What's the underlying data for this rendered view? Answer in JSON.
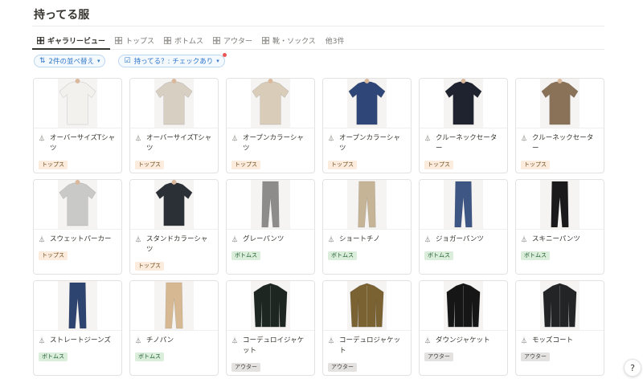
{
  "page": {
    "title": "持ってる服"
  },
  "tabs": [
    {
      "label": "ギャラリービュー",
      "active": true
    },
    {
      "label": "トップス",
      "active": false
    },
    {
      "label": "ボトムス",
      "active": false
    },
    {
      "label": "アウター",
      "active": false
    },
    {
      "label": "靴・ソックス",
      "active": false
    }
  ],
  "tabs_more": "他3件",
  "filters": {
    "sort_label": "2件の並べ替え",
    "filter_label": "持ってる？: チェックあり"
  },
  "categories": {
    "tops": "トップス",
    "bottoms": "ボトムス",
    "outer": "アウター"
  },
  "cards": [
    {
      "name": "オーバーサイズTシャツ",
      "tag": "トップス",
      "kind": "tops",
      "color": "#f2f1ee"
    },
    {
      "name": "オーバーサイズTシャツ",
      "tag": "トップス",
      "kind": "tops",
      "color": "#d8cfc3"
    },
    {
      "name": "オープンカラーシャツ",
      "tag": "トップス",
      "kind": "tops",
      "color": "#d9cdb9"
    },
    {
      "name": "オープンカラーシャツ",
      "tag": "トップス",
      "kind": "tops",
      "color": "#2f4778"
    },
    {
      "name": "クルーネックセーター",
      "tag": "トップス",
      "kind": "tops",
      "color": "#1f2330"
    },
    {
      "name": "クルーネックセーター",
      "tag": "トップス",
      "kind": "tops",
      "color": "#8a7258"
    },
    {
      "name": "スウェットパーカー",
      "tag": "トップス",
      "kind": "tops",
      "color": "#c9c9c7"
    },
    {
      "name": "スタンドカラーシャツ",
      "tag": "トップス",
      "kind": "tops",
      "color": "#2b2f36"
    },
    {
      "name": "グレーパンツ",
      "tag": "ボトムス",
      "kind": "bottoms",
      "color": "#8d8c8a"
    },
    {
      "name": "ショートチノ",
      "tag": "ボトムス",
      "kind": "bottoms",
      "color": "#c6b497"
    },
    {
      "name": "ジョガーパンツ",
      "tag": "ボトムス",
      "kind": "bottoms",
      "color": "#3d5684"
    },
    {
      "name": "スキニーパンツ",
      "tag": "ボトムス",
      "kind": "bottoms",
      "color": "#1a1a1c"
    },
    {
      "name": "ストレートジーンズ",
      "tag": "ボトムス",
      "kind": "bottoms",
      "color": "#2e4470"
    },
    {
      "name": "チノパン",
      "tag": "ボトムス",
      "kind": "bottoms",
      "color": "#d6b992"
    },
    {
      "name": "コーデュロイジャケット",
      "tag": "アウター",
      "kind": "outer",
      "color": "#1d2620"
    },
    {
      "name": "コーデュロジャケット",
      "tag": "アウター",
      "kind": "outer",
      "color": "#7a6233"
    },
    {
      "name": "ダウンジャケット",
      "tag": "アウター",
      "kind": "outer",
      "color": "#161617"
    },
    {
      "name": "モッズコート",
      "tag": "アウター",
      "kind": "outer",
      "color": "#232426"
    }
  ],
  "help_label": "?"
}
